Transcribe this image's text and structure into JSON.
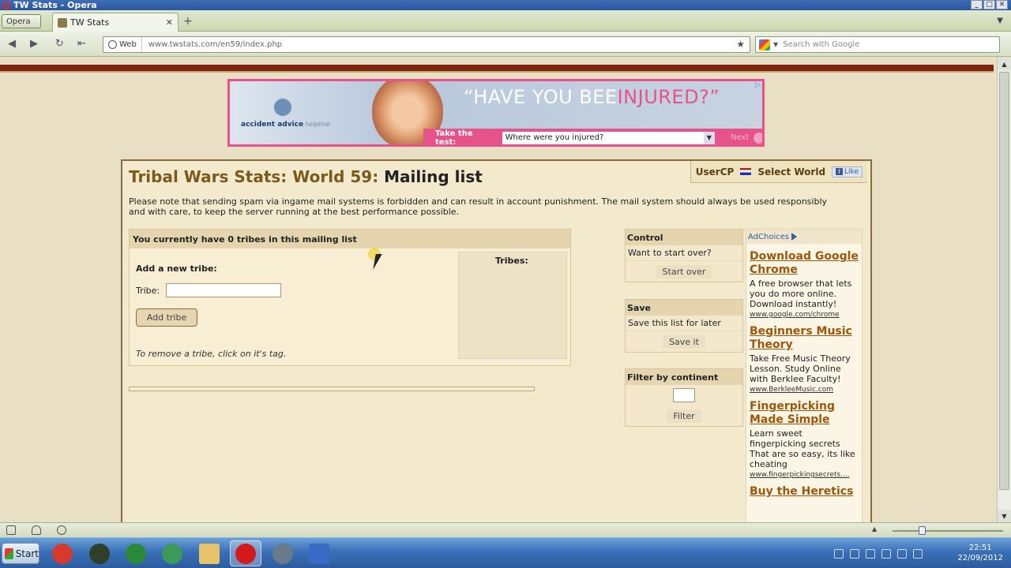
{
  "window": {
    "title": "TW Stats - Opera"
  },
  "browser": {
    "menu_label": "Opera",
    "tab_title": "TW Stats",
    "tab_close": "✕",
    "new_tab": "+",
    "web_label": "Web",
    "url": "www.twstats.com/en59/index.php",
    "search_placeholder": "Search with Google"
  },
  "ad_banner": {
    "brand": "accident advice",
    "brand_sub": "helpline",
    "headline_part1": "“HAVE",
    "headline_part2": " YOU BEE",
    "headline_part3": "INJURED?”",
    "prompt_label": "Take the test:",
    "select_value": "Where were you injured?",
    "next_label": "Next",
    "adchoices_mark": "▷"
  },
  "page": {
    "title_site": "Tribal Wars Stats",
    "title_sep": ": ",
    "title_world": "World 59",
    "title_sep2": ": ",
    "title_current": "Mailing list",
    "usercp_label": "UserCP",
    "select_world_label": "Select World",
    "like_label": "Like",
    "notice": "Please note that sending spam via ingame mail systems is forbidden and can result in account punishment. The mail system should always be used responsibly and with care, to keep the server running at the best performance possible."
  },
  "mailing": {
    "header": "You currently have 0 tribes in this mailing list",
    "add_label": "Add a new tribe:",
    "tribe_label": "Tribe:",
    "tribe_value": "",
    "add_button": "Add tribe",
    "remove_hint": "To remove a tribe, click on it's tag.",
    "tribes_header": "Tribes:"
  },
  "control": {
    "header": "Control",
    "text": "Want to start over?",
    "button": "Start over"
  },
  "save": {
    "header": "Save",
    "text": "Save this list for later",
    "button": "Save it"
  },
  "filter": {
    "header": "Filter by continent",
    "input_value": "",
    "button": "Filter"
  },
  "ads": {
    "adchoices": "AdChoices",
    "items": [
      {
        "title": "Download Google Chrome",
        "text": "A free browser that lets you do more online. Download instantly!",
        "link": "www.google.com/chrome"
      },
      {
        "title": "Beginners Music Theory",
        "text": "Take Free Music Theory Lesson. Study Online with Berklee Faculty!",
        "link": "www.BerkleeMusic.com"
      },
      {
        "title": "Fingerpicking Made Simple",
        "text": "Learn sweet fingerpicking secrets That are so easy, its like cheating",
        "link": "www.fingerpickingsecrets...."
      },
      {
        "title": "Buy the Heretics",
        "text": "",
        "link": ""
      }
    ]
  },
  "taskbar": {
    "start_label": "Start",
    "clock_time": "22:51",
    "clock_date": "22/09/2012",
    "apps": [
      "chrome-icon",
      "game-icon",
      "spotify-icon",
      "app-icon",
      "folder-icon",
      "opera-icon",
      "tool-icon",
      "save-icon"
    ],
    "colors": {
      "chrome": "#d63a2a",
      "game": "#2f3f2a",
      "spotify": "#2a8a3a",
      "app": "#3a9a5a",
      "folder": "#e6c36a",
      "opera": "#d41a1a",
      "tool": "#6a7a8a",
      "save": "#3a6ac8"
    }
  },
  "colors": {
    "page_bg": "#e9dfc4",
    "heading_brown": "#7a5a1a",
    "ad_pink": "#e8528a",
    "ad_link": "#a0560a"
  }
}
